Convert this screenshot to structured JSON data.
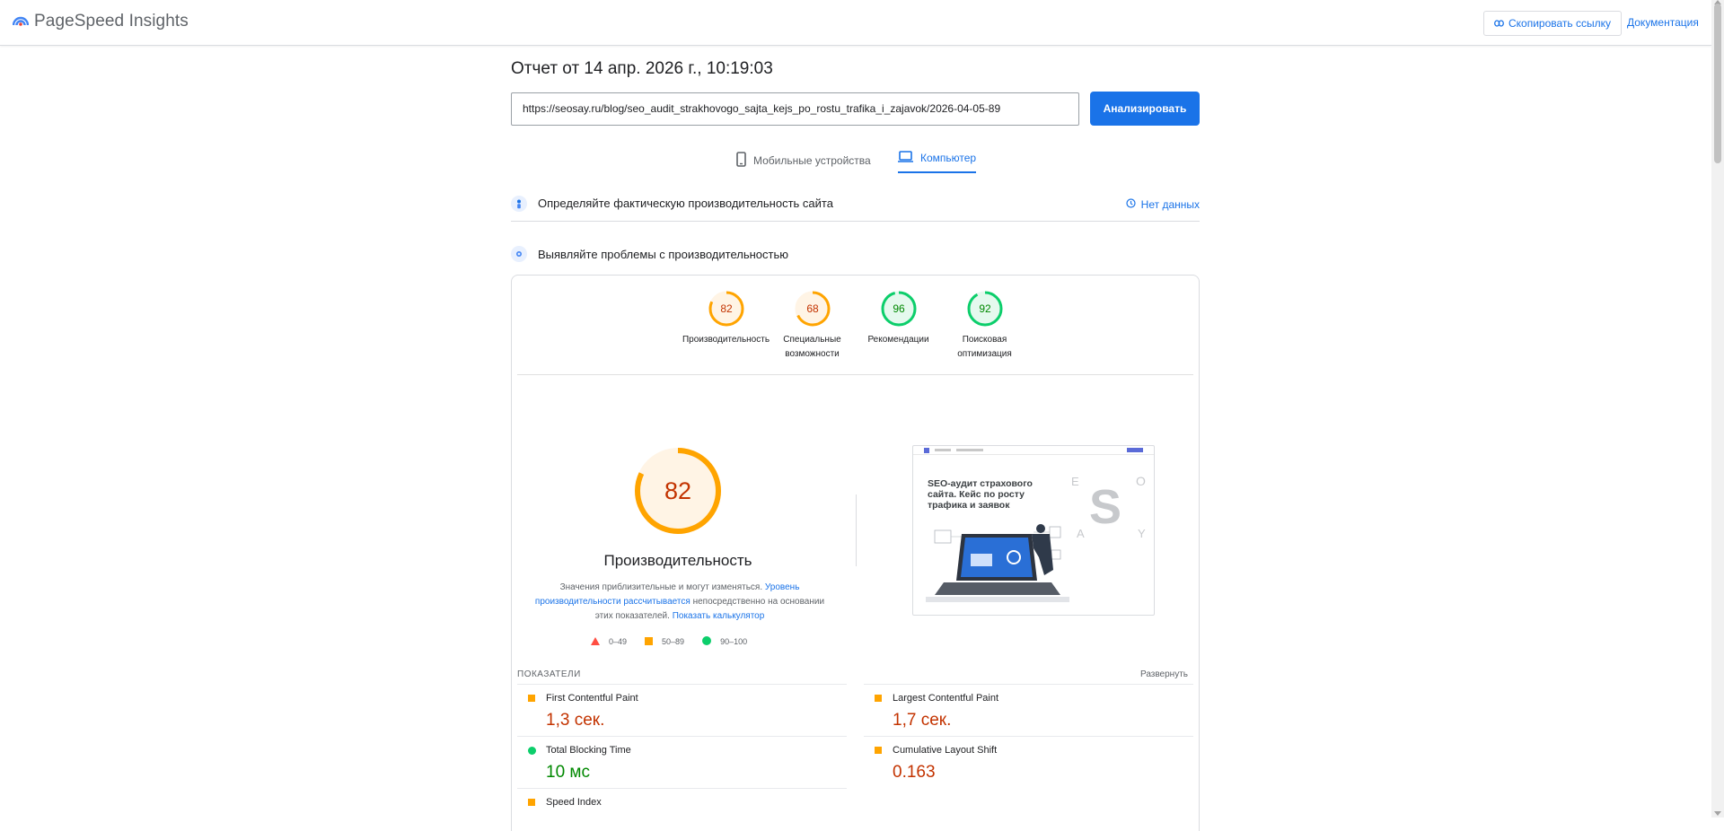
{
  "header": {
    "brand": "PageSpeed Insights",
    "copy_link": "Скопировать ссылку",
    "docs": "Документация"
  },
  "report": {
    "title": "Отчет от 14 апр. 2026 г., 10:19:03",
    "url": "https://seosay.ru/blog/seo_audit_strakhovogo_sajta_kejs_po_rostu_trafika_i_zajavok/2026-04-05-89",
    "analyze": "Анализировать"
  },
  "tabs": [
    {
      "label": "Мобильные устройства",
      "active": false
    },
    {
      "label": "Компьютер",
      "active": true
    }
  ],
  "field_section": {
    "title": "Определяйте фактическую производительность сайта",
    "status": "Нет данных"
  },
  "lab_section": {
    "title": "Выявляйте проблемы с производительностью"
  },
  "scores": [
    {
      "value": "82",
      "label": "Производительность",
      "score": 82,
      "color": "#ffa400",
      "text_color": "#c33300"
    },
    {
      "value": "68",
      "label": "Специальные возможности",
      "score": 68,
      "color": "#ffa400",
      "text_color": "#c33300"
    },
    {
      "value": "96",
      "label": "Рекомендации",
      "score": 96,
      "color": "#0cce6b",
      "text_color": "#008800"
    },
    {
      "value": "92",
      "label": "Поисковая оптимизация",
      "score": 92,
      "color": "#0cce6b",
      "text_color": "#008800"
    }
  ],
  "performance": {
    "score": "82",
    "score_value": 82,
    "title": "Производительность",
    "desc_1": "Значения приблизительные и могут изменяться. ",
    "desc_link_1": "Уровень производительности рассчитывается",
    "desc_2": " непосредственно на основании этих показателей. ",
    "desc_link_2": "Показать калькулятор"
  },
  "legend": [
    {
      "range": "0–49",
      "shape": "triangle",
      "color": "#ff4e42"
    },
    {
      "range": "50–89",
      "shape": "square",
      "color": "#ffa400"
    },
    {
      "range": "90–100",
      "shape": "circle",
      "color": "#0cce6b"
    }
  ],
  "screenshot": {
    "headline": "SEO-аудит страхового сайта. Кейс по росту трафика и заявок",
    "letters": [
      "E",
      "O",
      "S",
      "A",
      "Y"
    ]
  },
  "metrics": {
    "heading": "ПОКАЗАТЕЛИ",
    "expand": "Развернуть",
    "items": [
      {
        "name": "First Contentful Paint",
        "value": "1,3 сек.",
        "status": "average"
      },
      {
        "name": "Largest Contentful Paint",
        "value": "1,7 сек.",
        "status": "average"
      },
      {
        "name": "Total Blocking Time",
        "value": "10 мс",
        "status": "pass"
      },
      {
        "name": "Cumulative Layout Shift",
        "value": "0.163",
        "status": "average"
      },
      {
        "name": "Speed Index",
        "value": "",
        "status": "average"
      }
    ]
  },
  "colors": {
    "accent": "#1a73e8",
    "average": "#ffa400",
    "pass": "#0cce6b",
    "average_text": "#c33300",
    "pass_text": "#008800"
  }
}
